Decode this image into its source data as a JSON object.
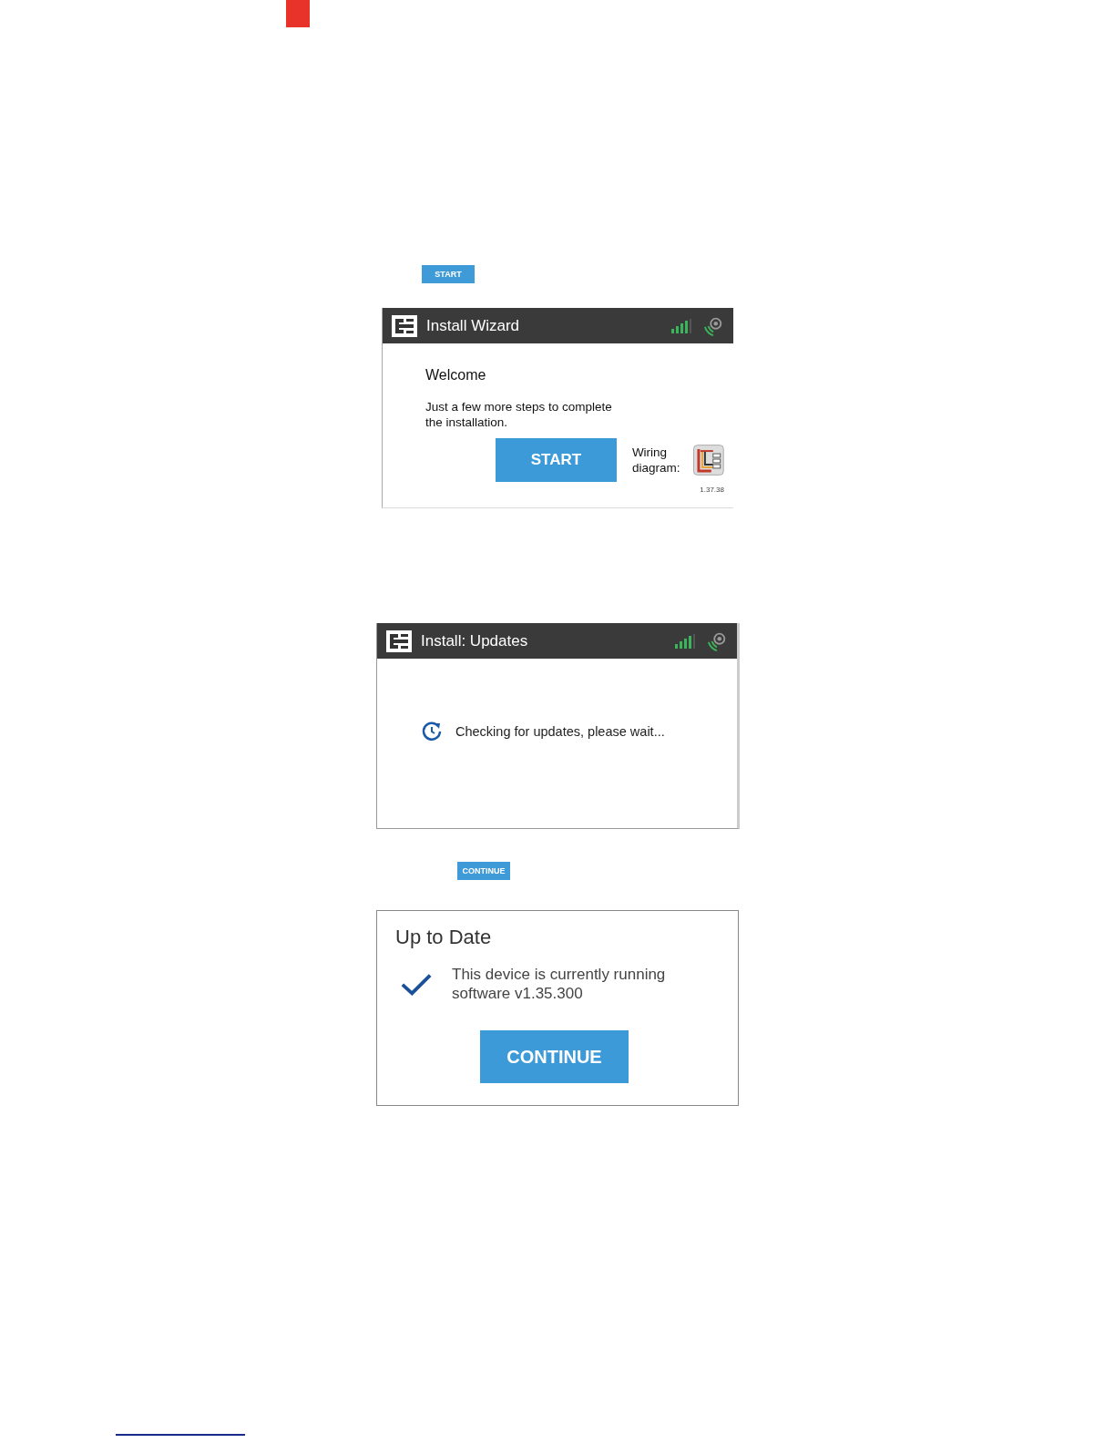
{
  "inline_buttons": [
    {
      "label": "START"
    },
    {
      "label": "CONTINUE"
    }
  ],
  "wizard_screen": {
    "title": "Install Wizard",
    "heading": "Welcome",
    "message": "Just a few more steps to complete the installation.",
    "start_button": "START",
    "wiring_label": "Wiring diagram:",
    "version": "1.37.38"
  },
  "updates_screen": {
    "title": "Install: Updates",
    "status": "Checking for updates, please wait..."
  },
  "up_to_date_dialog": {
    "title": "Up to Date",
    "message": "This device is currently running software v1.35.300",
    "button": "CONTINUE"
  }
}
